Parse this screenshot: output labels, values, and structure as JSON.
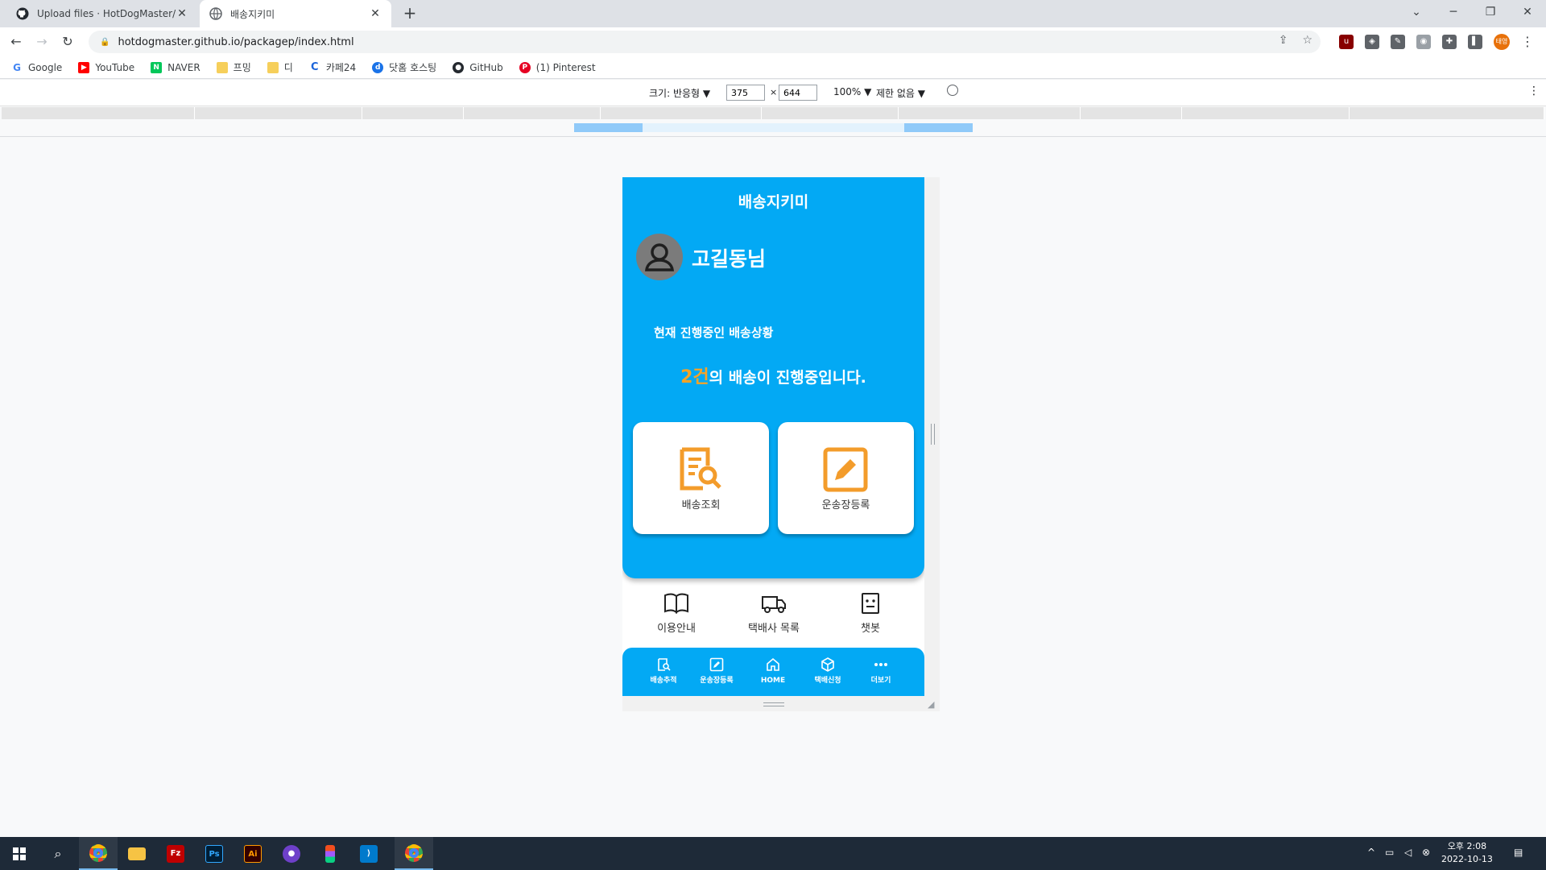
{
  "browser": {
    "tabs": [
      {
        "title": "Upload files · HotDogMaster/Pa",
        "active": false
      },
      {
        "title": "배송지키미",
        "active": true
      }
    ],
    "url": "hotdogmaster.github.io/packagep/index.html",
    "bookmarks": [
      "Google",
      "YouTube",
      "NAVER",
      "프밍",
      "디",
      "카페24",
      "닷홈 호스팅",
      "GitHub",
      "(1) Pinterest"
    ],
    "profile_label": "태영"
  },
  "devtools": {
    "size_label": "크기: 반응형 ▼",
    "width": "375",
    "height": "644",
    "times": "×",
    "zoom": "100% ▼",
    "throttle": "제한 없음 ▼"
  },
  "app": {
    "title": "배송지키미",
    "username": "고길동님",
    "status_label": "현재 진행중인 배송상황",
    "status_count": "2건",
    "status_suffix": "의 배송이 진행중입니다.",
    "cards": [
      {
        "label": "배송조회",
        "icon": "search-document-icon"
      },
      {
        "label": "운송장등록",
        "icon": "edit-icon"
      }
    ],
    "quick_links": [
      {
        "label": "이용안내",
        "icon": "book-icon"
      },
      {
        "label": "택배사 목록",
        "icon": "truck-icon"
      },
      {
        "label": "챗봇",
        "icon": "robot-icon"
      }
    ],
    "bottom_nav": [
      {
        "label": "배송추적",
        "icon": "search-document-icon"
      },
      {
        "label": "운송장등록",
        "icon": "edit-icon"
      },
      {
        "label": "HOME",
        "icon": "home-icon"
      },
      {
        "label": "택배신청",
        "icon": "box-icon"
      },
      {
        "label": "더보기",
        "icon": "more-icon"
      }
    ],
    "accent": "#03a9f4",
    "highlight": "#f7a325"
  },
  "taskbar": {
    "clock_time": "오후 2:08",
    "clock_date": "2022-10-13"
  }
}
